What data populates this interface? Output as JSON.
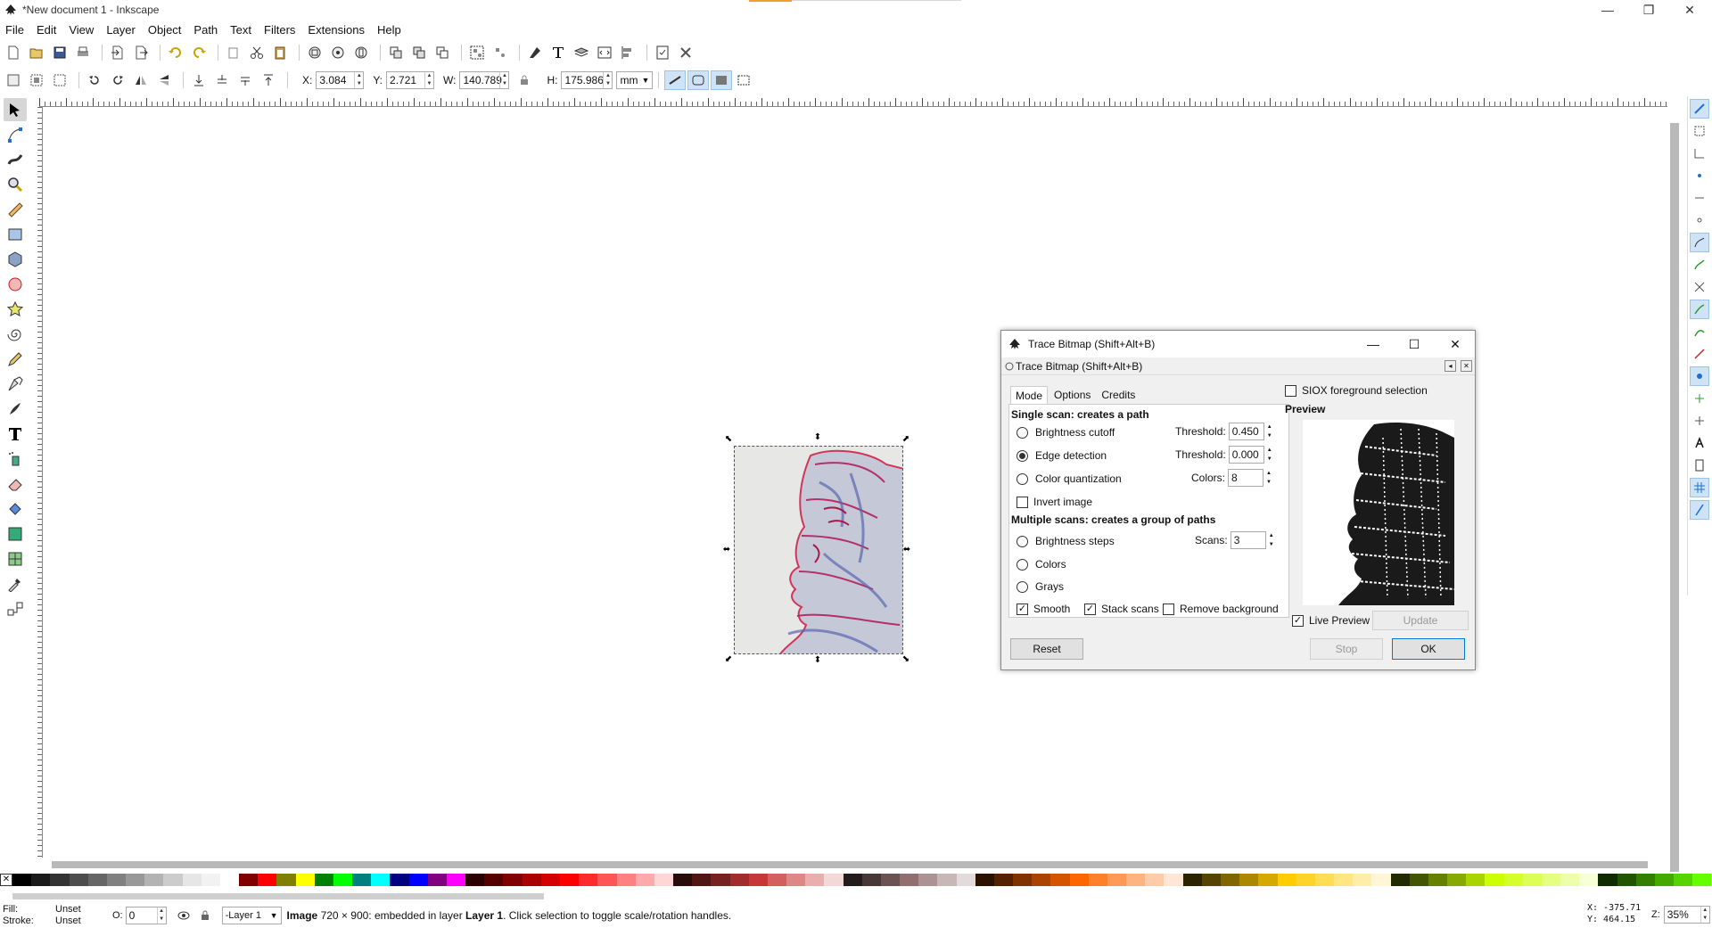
{
  "window": {
    "title": "*New document 1 - Inkscape",
    "minimize": "—",
    "maximize": "❐",
    "close": "✕"
  },
  "menu": [
    "File",
    "Edit",
    "View",
    "Layer",
    "Object",
    "Path",
    "Text",
    "Filters",
    "Extensions",
    "Help"
  ],
  "tool_controls": {
    "x_label": "X:",
    "x_value": "3.084",
    "y_label": "Y:",
    "y_value": "2.721",
    "w_label": "W:",
    "w_value": "140.789",
    "h_label": "H:",
    "h_value": "175.986",
    "unit": "mm"
  },
  "dialog": {
    "window_title": "Trace Bitmap (Shift+Alt+B)",
    "panel_title": "Trace Bitmap (Shift+Alt+B)",
    "tabs": [
      "Mode",
      "Options",
      "Credits"
    ],
    "single_scan_title": "Single scan: creates a path",
    "brightness_cutoff": "Brightness cutoff",
    "edge_detection": "Edge detection",
    "color_quantization": "Color quantization",
    "invert_image": "Invert image",
    "threshold_label": "Threshold:",
    "threshold1": "0.450",
    "threshold2": "0.000",
    "colors_label": "Colors:",
    "colors_value": "8",
    "multi_scan_title": "Multiple scans: creates a group of paths",
    "brightness_steps": "Brightness steps",
    "colors_option": "Colors",
    "grays_option": "Grays",
    "scans_label": "Scans:",
    "scans_value": "3",
    "smooth": "Smooth",
    "stack_scans": "Stack scans",
    "remove_background": "Remove background",
    "siox": "SIOX foreground selection",
    "preview_label": "Preview",
    "live_preview": "Live Preview",
    "update": "Update",
    "reset": "Reset",
    "stop": "Stop",
    "ok": "OK"
  },
  "status": {
    "fill_label": "Fill:",
    "stroke_label": "Stroke:",
    "fill_value": "Unset",
    "stroke_value": "Unset",
    "opacity_label": "O:",
    "opacity_value": "0",
    "layer": "-Layer 1",
    "msg_bold1": "Image",
    "msg_1": " 720 × 900: embedded in layer ",
    "msg_bold2": "Layer 1",
    "msg_2": ". Click selection to toggle scale/rotation handles.",
    "coord_x": "X: -375.71",
    "coord_y": "Y:  464.15",
    "zoom_label": "Z:",
    "zoom_value": "35%"
  },
  "palette_colors": [
    "#000000",
    "#1a1a1a",
    "#333333",
    "#4d4d4d",
    "#666666",
    "#808080",
    "#999999",
    "#b3b3b3",
    "#cccccc",
    "#e6e6e6",
    "#f2f2f2",
    "#ffffff",
    "#800000",
    "#ff0000",
    "#808000",
    "#ffff00",
    "#008000",
    "#00ff00",
    "#008080",
    "#00ffff",
    "#000080",
    "#0000ff",
    "#800080",
    "#ff00ff",
    "#2b0000",
    "#550000",
    "#800000",
    "#aa0000",
    "#d40000",
    "#ff0000",
    "#ff2a2a",
    "#ff5555",
    "#ff8080",
    "#ffaaaa",
    "#ffd5d5",
    "#280b0b",
    "#501616",
    "#782121",
    "#a02c2c",
    "#c83737",
    "#d35f5f",
    "#de8787",
    "#e9afaf",
    "#f4d7d7",
    "#241c1c",
    "#483737",
    "#6c5353",
    "#916f6f",
    "#ac9393",
    "#c8b7b7",
    "#e3dbdb",
    "#2b1100",
    "#552200",
    "#803300",
    "#aa4400",
    "#d45500",
    "#ff6600",
    "#ff7f2a",
    "#ff9955",
    "#ffb380",
    "#ffccaa",
    "#ffe6d5",
    "#2b2200",
    "#554400",
    "#806600",
    "#aa8800",
    "#d4aa00",
    "#ffcc00",
    "#ffd42a",
    "#ffdd55",
    "#ffe680",
    "#ffeeaa",
    "#fff6d5",
    "#222b00",
    "#445500",
    "#668000",
    "#88aa00",
    "#aad400",
    "#ccff00",
    "#d4ff2a",
    "#ddff55",
    "#e5ff80",
    "#eeffaa",
    "#f6ffd5",
    "#112b00",
    "#225500",
    "#338000",
    "#44aa00",
    "#55d400",
    "#66ff00"
  ]
}
